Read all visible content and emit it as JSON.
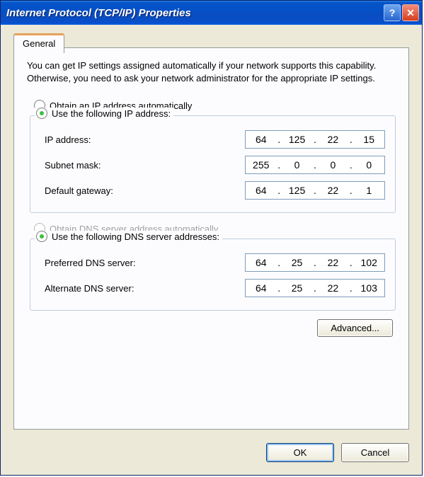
{
  "window": {
    "title": "Internet Protocol (TCP/IP) Properties"
  },
  "tabs": {
    "general": "General"
  },
  "intro": "You can get IP settings assigned automatically if your network supports this capability. Otherwise, you need to ask your network administrator for the appropriate IP settings.",
  "radios": {
    "obtain_ip": "Obtain an IP address automatically",
    "use_ip": "Use the following IP address:",
    "obtain_dns": "Obtain DNS server address automatically",
    "use_dns": "Use the following DNS server addresses:"
  },
  "labels": {
    "ip_address": "IP address:",
    "subnet_mask": "Subnet mask:",
    "default_gateway": "Default gateway:",
    "preferred_dns": "Preferred DNS server:",
    "alternate_dns": "Alternate DNS server:"
  },
  "values": {
    "ip": {
      "o1": "64",
      "o2": "125",
      "o3": "22",
      "o4": "15"
    },
    "mask": {
      "o1": "255",
      "o2": "0",
      "o3": "0",
      "o4": "0"
    },
    "gateway": {
      "o1": "64",
      "o2": "125",
      "o3": "22",
      "o4": "1"
    },
    "dns1": {
      "o1": "64",
      "o2": "25",
      "o3": "22",
      "o4": "102"
    },
    "dns2": {
      "o1": "64",
      "o2": "25",
      "o3": "22",
      "o4": "103"
    }
  },
  "buttons": {
    "advanced": "Advanced...",
    "ok": "OK",
    "cancel": "Cancel"
  }
}
